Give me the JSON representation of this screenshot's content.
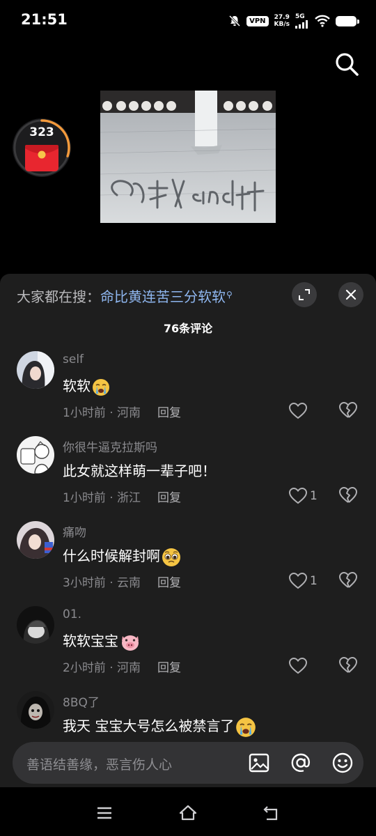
{
  "status_bar": {
    "time": "21:51",
    "vpn": "VPN",
    "speed_value": "27.9",
    "speed_unit": "KB/s",
    "network": "5G"
  },
  "red_packet": {
    "count": "323",
    "progress": 0.3
  },
  "hot_search": {
    "prefix": "大家都在搜：",
    "term": "命比黄连苦三分软软"
  },
  "comments_header": {
    "count_label": "76条评论"
  },
  "comments": [
    {
      "user": "self",
      "text": "软软",
      "emoji": "crying-emoji",
      "time": "1小时前",
      "region": "河南",
      "reply": "回复",
      "likes": ""
    },
    {
      "user": "你很牛逼克拉斯吗",
      "text": "此女就这样萌一辈子吧！",
      "emoji": "",
      "time": "1小时前",
      "region": "浙江",
      "reply": "回复",
      "likes": "1"
    },
    {
      "user": "痛吻",
      "text": "什么时候解封啊",
      "emoji": "pleading-emoji",
      "time": "3小时前",
      "region": "云南",
      "reply": "回复",
      "likes": "1"
    },
    {
      "user": "01.",
      "text": "软软宝宝",
      "emoji": "pig-face-emoji",
      "time": "2小时前",
      "region": "河南",
      "reply": "回复",
      "likes": ""
    },
    {
      "user": "8BQ了",
      "text": "我天 宝宝大号怎么被禁言了",
      "emoji": "crying-emoji",
      "time": "",
      "region": "",
      "reply": "",
      "likes": ""
    }
  ],
  "input": {
    "placeholder": "善语结善缘，恶言伤人心"
  },
  "colors": {
    "sheet_bg": "#1e1e1e",
    "link_blue": "#8fb7f0",
    "packet_red": "#e8262f",
    "progress_orange": "#f39a3c"
  }
}
